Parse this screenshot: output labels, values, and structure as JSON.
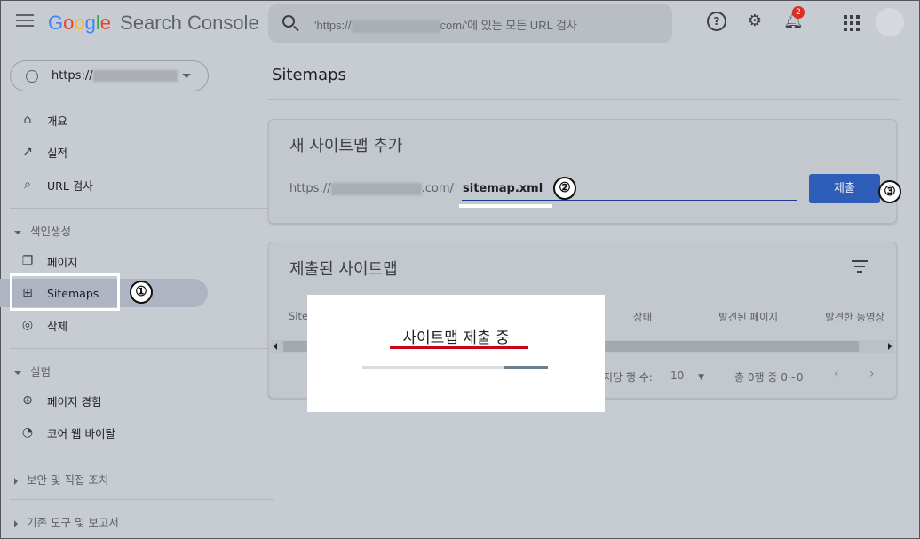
{
  "header": {
    "brand_google": [
      "G",
      "o",
      "o",
      "g",
      "l",
      "e"
    ],
    "brand_product": "Search Console",
    "search_placeholder_prefix": "'https://",
    "search_placeholder_suffix": "com/'에 있는 모든 URL 검사",
    "notification_count": "2"
  },
  "sidebar": {
    "property_label": "https://",
    "items_top": [
      {
        "label": "개요",
        "icon": "home-icon",
        "glyph": "⌂"
      },
      {
        "label": "실적",
        "icon": "trending-up-icon",
        "glyph": "↗"
      },
      {
        "label": "URL 검사",
        "icon": "search-icon",
        "glyph": "⌕"
      }
    ],
    "section_index": "색인생성",
    "items_index": [
      {
        "label": "페이지",
        "icon": "pages-icon",
        "glyph": "❐"
      },
      {
        "label": "Sitemaps",
        "icon": "sitemap-icon",
        "glyph": "⊞"
      },
      {
        "label": "삭제",
        "icon": "visibility-off-icon",
        "glyph": "◎"
      }
    ],
    "section_experience": "실험",
    "items_experience": [
      {
        "label": "페이지 경험",
        "icon": "add-circle-icon",
        "glyph": "⊕"
      },
      {
        "label": "코어 웹 바이탈",
        "icon": "speed-icon",
        "glyph": "◔"
      }
    ],
    "section_security": "보안 및 직접 조치",
    "section_legacy": "기존 도구 및 보고서"
  },
  "main": {
    "page_title": "Sitemaps",
    "add_card": {
      "title": "새 사이트맵 추가",
      "prefix_start": "https://",
      "prefix_end": ".com/",
      "input_value": "sitemap.xml",
      "submit_label": "제출"
    },
    "submitted_card": {
      "title": "제출된 사이트맵",
      "columns": [
        "Site",
        "상태",
        "발견된 페이지",
        "발견한 동영상"
      ],
      "rows_per_page_label": "지당 행 수:",
      "rows_per_page_value": "10",
      "range_label": "총 0행 중 0~0"
    }
  },
  "annotations": {
    "step1": "①",
    "step2": "②",
    "step3": "③"
  },
  "modal": {
    "title": "사이트맵 제출 중",
    "progress": 0.24
  },
  "colors": {
    "submit_button": "#2d5db8",
    "highlight_underline": "#d0021b",
    "notification_badge": "#d93025"
  }
}
